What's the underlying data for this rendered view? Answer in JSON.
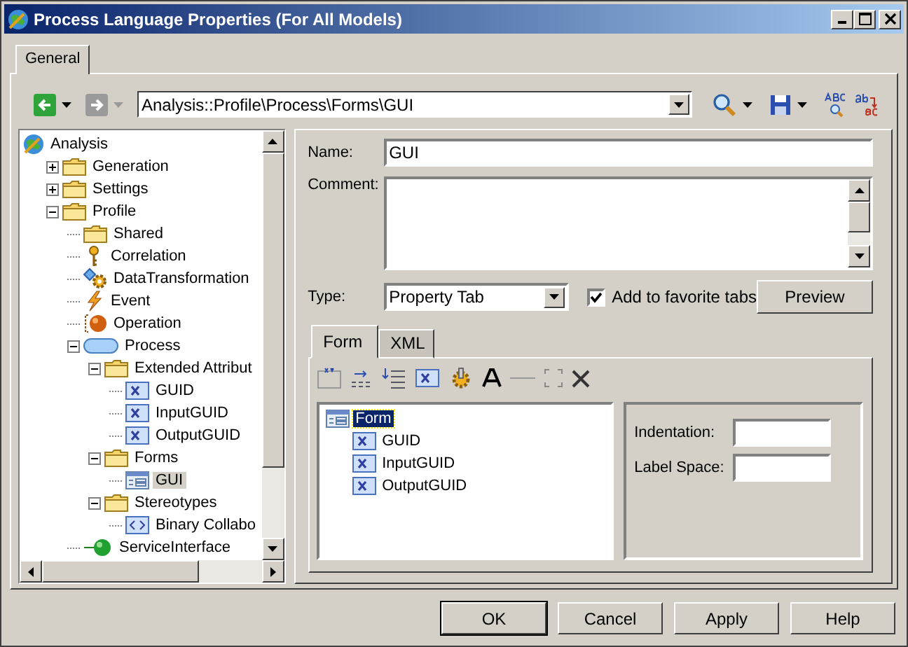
{
  "window": {
    "title": "Process Language Properties (For All Models)"
  },
  "tabs": [
    {
      "label": "General",
      "selected": true
    }
  ],
  "nav": [
    {
      "kind": "back",
      "disabled": false
    },
    {
      "kind": "forward",
      "disabled": true
    }
  ],
  "path": "Analysis::Profile\\Process\\Forms\\GUI",
  "tree": {
    "items": [
      {
        "label": "Analysis",
        "kind": "root",
        "selected": false,
        "children": [
          {
            "label": "Generation",
            "kind": "folder",
            "selected": false,
            "expanded": false
          },
          {
            "label": "Settings",
            "kind": "folder",
            "selected": false,
            "expanded": false
          },
          {
            "label": "Profile",
            "kind": "folder",
            "selected": false,
            "expanded": true,
            "children": [
              {
                "label": "Shared",
                "kind": "folder",
                "selected": false
              },
              {
                "label": "Correlation",
                "kind": "key",
                "selected": false
              },
              {
                "label": "DataTransformation",
                "kind": "transform",
                "selected": false
              },
              {
                "label": "Event",
                "kind": "event",
                "selected": false
              },
              {
                "label": "Operation",
                "kind": "operation",
                "selected": false
              },
              {
                "label": "Process",
                "kind": "process",
                "selected": false,
                "expanded": true,
                "children": [
                  {
                    "label": "Extended Attribut",
                    "kind": "folder",
                    "selected": false,
                    "expanded": true,
                    "children": [
                      {
                        "label": "GUID",
                        "kind": "attribute",
                        "selected": false
                      },
                      {
                        "label": "InputGUID",
                        "kind": "attribute",
                        "selected": false
                      },
                      {
                        "label": "OutputGUID",
                        "kind": "attribute",
                        "selected": false
                      }
                    ]
                  },
                  {
                    "label": "Forms",
                    "kind": "folder",
                    "selected": false,
                    "expanded": true,
                    "children": [
                      {
                        "label": "GUI",
                        "kind": "form",
                        "selected": true
                      }
                    ]
                  },
                  {
                    "label": "Stereotypes",
                    "kind": "folder",
                    "selected": false,
                    "expanded": true,
                    "children": [
                      {
                        "label": "Binary Collabo",
                        "kind": "stereotype",
                        "selected": false
                      }
                    ]
                  }
                ]
              },
              {
                "label": "ServiceInterface",
                "kind": "interface",
                "selected": false
              }
            ]
          }
        ]
      }
    ]
  },
  "name": {
    "label": "Name:",
    "value": "GUI"
  },
  "comment": {
    "label": "Comment:"
  },
  "type": {
    "label": "Type:",
    "value": "Property Tab"
  },
  "favorite": {
    "label": "Add to favorite tabs",
    "checked": true
  },
  "preview": "Preview",
  "subtabs": [
    {
      "label": "Form",
      "selected": true
    },
    {
      "label": "XML",
      "selected": false
    }
  ],
  "form_tree": {
    "items": [
      {
        "label": "Form",
        "kind": "form",
        "selected": true,
        "children": [
          {
            "label": "GUID",
            "kind": "attribute",
            "selected": false
          },
          {
            "label": "InputGUID",
            "kind": "attribute",
            "selected": false
          },
          {
            "label": "OutputGUID",
            "kind": "attribute",
            "selected": false
          }
        ]
      }
    ]
  },
  "properties": [
    {
      "label": "Indentation:"
    },
    {
      "label": "Label Space:"
    }
  ],
  "buttons": [
    {
      "label": "OK",
      "default": true
    },
    {
      "label": "Cancel",
      "default": false
    },
    {
      "label": "Apply",
      "default": false
    },
    {
      "label": "Help",
      "default": false
    }
  ]
}
